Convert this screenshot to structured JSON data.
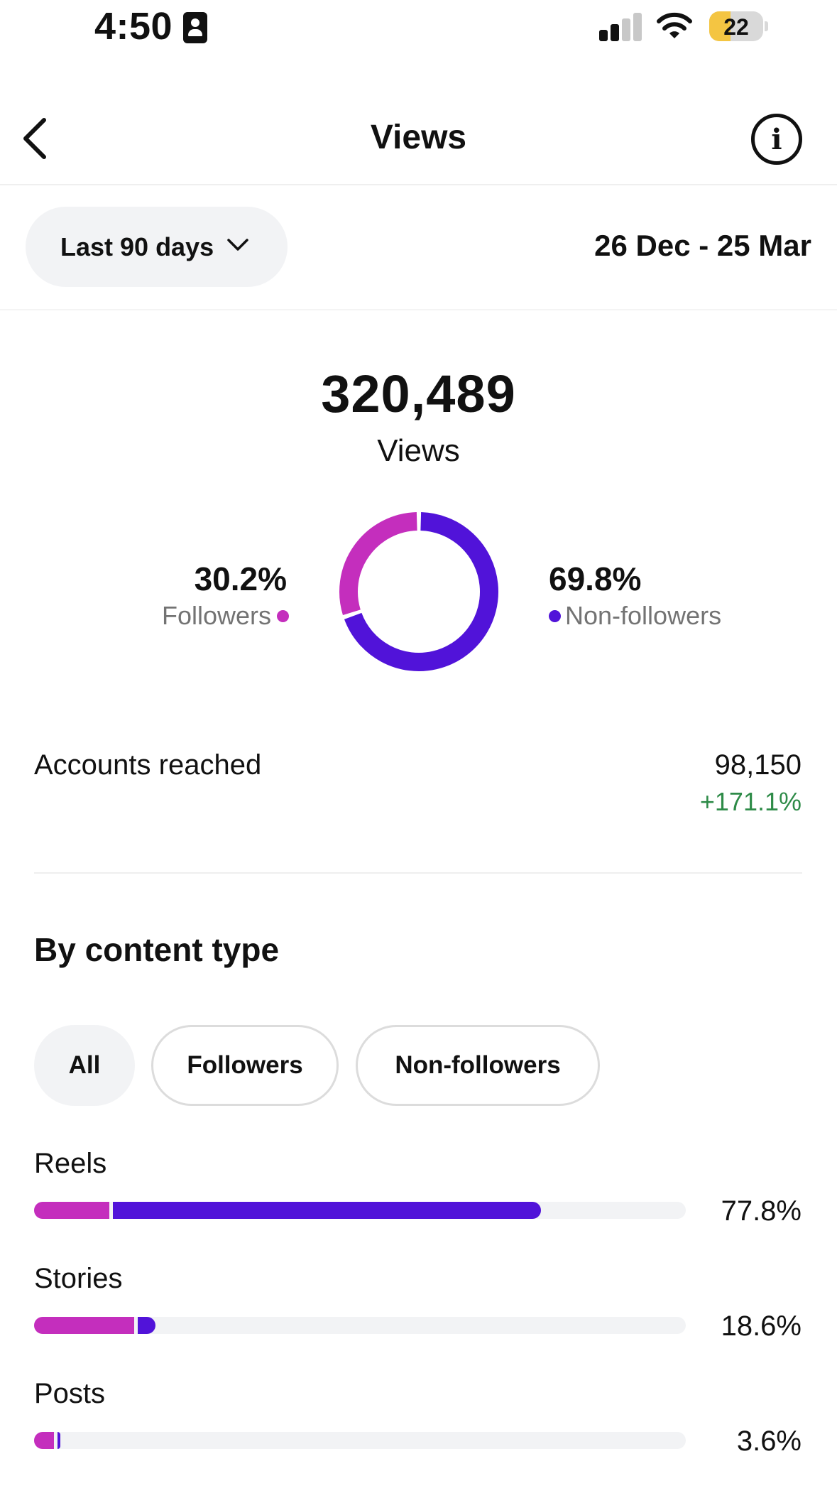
{
  "status_bar": {
    "time": "4:50",
    "battery": "22"
  },
  "header": {
    "title": "Views",
    "back_icon": "chevron-left-icon",
    "info_icon": "info-icon",
    "info_glyph": "i"
  },
  "date_filter": {
    "selected": "Last 90 days",
    "range": "26 Dec - 25 Mar"
  },
  "summary": {
    "total": "320,489",
    "label": "Views",
    "followers_pct": "30.2%",
    "followers_label": "Followers",
    "non_followers_pct": "69.8%",
    "non_followers_label": "Non-followers"
  },
  "reach": {
    "label": "Accounts reached",
    "value": "98,150",
    "change": "+171.1%"
  },
  "content_type": {
    "title": "By content type",
    "filters": [
      "All",
      "Followers",
      "Non-followers"
    ],
    "active_filter": "All",
    "rows": [
      {
        "label": "Reels",
        "pct": "77.8%",
        "followers_frac": 0.115,
        "non_followers_frac": 0.663
      },
      {
        "label": "Stories",
        "pct": "18.6%",
        "followers_frac": 0.154,
        "non_followers_frac": 0.032
      },
      {
        "label": "Posts",
        "pct": "3.6%",
        "followers_frac": 0.03,
        "non_followers_frac": 0.006
      }
    ]
  },
  "colors": {
    "followers": "#c42ebd",
    "non_followers": "#5113d9",
    "positive": "#2e8b48"
  },
  "chart_data": [
    {
      "type": "pie",
      "categories": [
        "Followers",
        "Non-followers"
      ],
      "values": [
        30.2,
        69.8
      ],
      "title": "",
      "xlabel": "",
      "ylabel": ""
    },
    {
      "type": "bar",
      "categories": [
        "Reels",
        "Stories",
        "Posts"
      ],
      "values": [
        77.8,
        18.6,
        3.6
      ],
      "title": "By content type",
      "xlabel": "",
      "ylabel": ""
    }
  ]
}
